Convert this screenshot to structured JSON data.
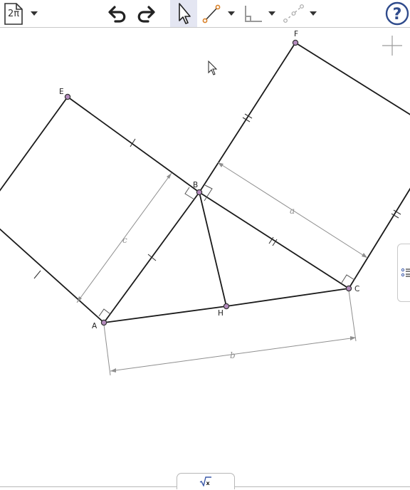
{
  "toolbar": {
    "document_label": "2π",
    "icons": [
      "document-icon",
      "undo-icon",
      "redo-icon",
      "move-tool-icon",
      "segment-tool-icon",
      "perpendicular-tool-icon",
      "point-tool-icon",
      "help-icon"
    ]
  },
  "geometry": {
    "points": [
      {
        "id": "A",
        "label": "A"
      },
      {
        "id": "B",
        "label": "B"
      },
      {
        "id": "C",
        "label": "C"
      },
      {
        "id": "H",
        "label": "H"
      },
      {
        "id": "E",
        "label": "E"
      },
      {
        "id": "F",
        "label": "F"
      }
    ],
    "measure_labels": {
      "a": "a",
      "b": "b",
      "c": "c"
    }
  },
  "colors": {
    "segment": "#1a1a1a",
    "measure": "#8f8f8f",
    "point_fill": "#b48bbd",
    "accent": "#3a58a8",
    "help": "#2f4b8c"
  }
}
